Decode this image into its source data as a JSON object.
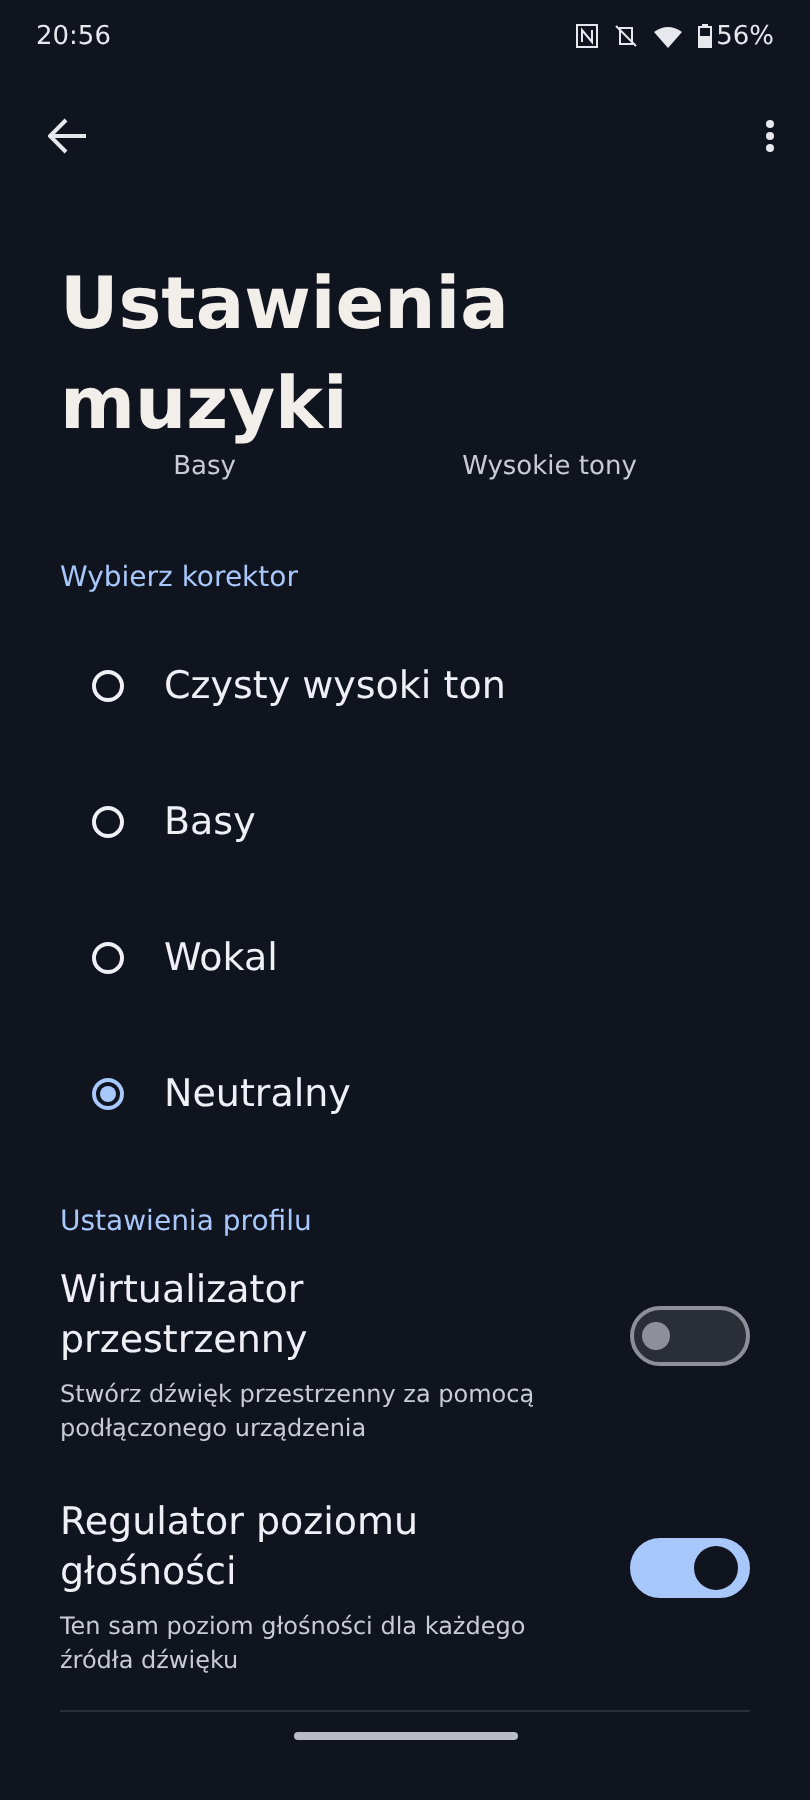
{
  "status_bar": {
    "time": "20:56",
    "battery": "56%"
  },
  "title": "Ustawienia muzyki",
  "eq_labels": [
    "Basy",
    "Wysokie tony"
  ],
  "equalizer": {
    "header": "Wybierz korektor",
    "options": [
      {
        "label": "Czysty wysoki ton",
        "selected": false
      },
      {
        "label": "Basy",
        "selected": false
      },
      {
        "label": "Wokal",
        "selected": false
      },
      {
        "label": "Neutralny",
        "selected": true
      }
    ]
  },
  "profile": {
    "header": "Ustawienia profilu",
    "items": [
      {
        "title": "Wirtualizator przestrzenny",
        "description": "Stwórz dźwięk przestrzenny za pomocą podłączonego urządzenia",
        "on": false
      },
      {
        "title": "Regulator poziomu głośności",
        "description": "Ten sam poziom głośności dla każdego źródła dźwięku",
        "on": true
      }
    ]
  }
}
